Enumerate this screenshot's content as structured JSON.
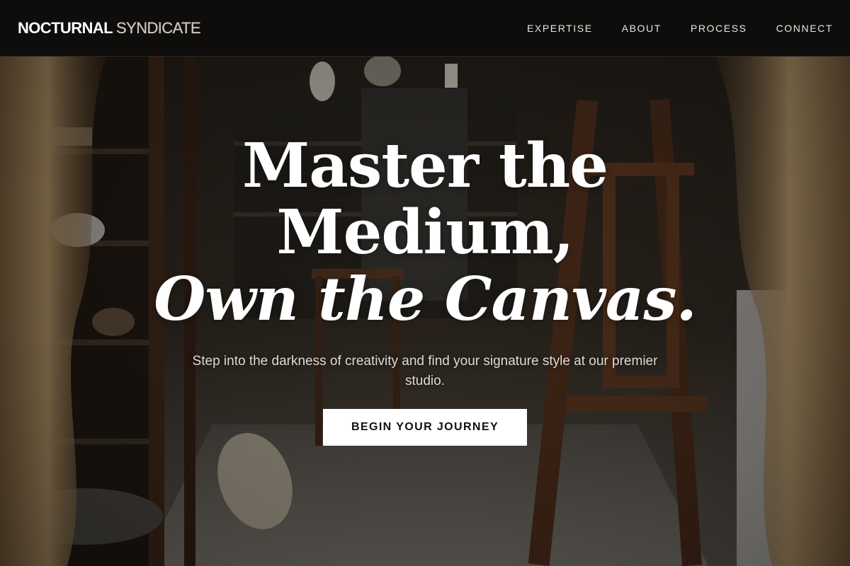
{
  "brand": {
    "primary": "NOCTURNAL",
    "secondary": "SYNDICATE"
  },
  "nav": {
    "items": [
      {
        "label": "EXPERTISE"
      },
      {
        "label": "ABOUT"
      },
      {
        "label": "PROCESS"
      },
      {
        "label": "CONNECT"
      }
    ]
  },
  "hero": {
    "title_line_1": "Master the",
    "title_line_2": "Medium,",
    "title_line_3": "Own the Canvas.",
    "subtitle": "Step into the darkness of creativity and find your signature style at our premier studio.",
    "cta_label": "BEGIN YOUR JOURNEY"
  },
  "colors": {
    "navbar_bg": "#0e0d0c",
    "text_primary": "#ffffff",
    "text_secondary": "#c9c5c0",
    "cta_bg": "#ffffff",
    "cta_text": "#111111"
  }
}
